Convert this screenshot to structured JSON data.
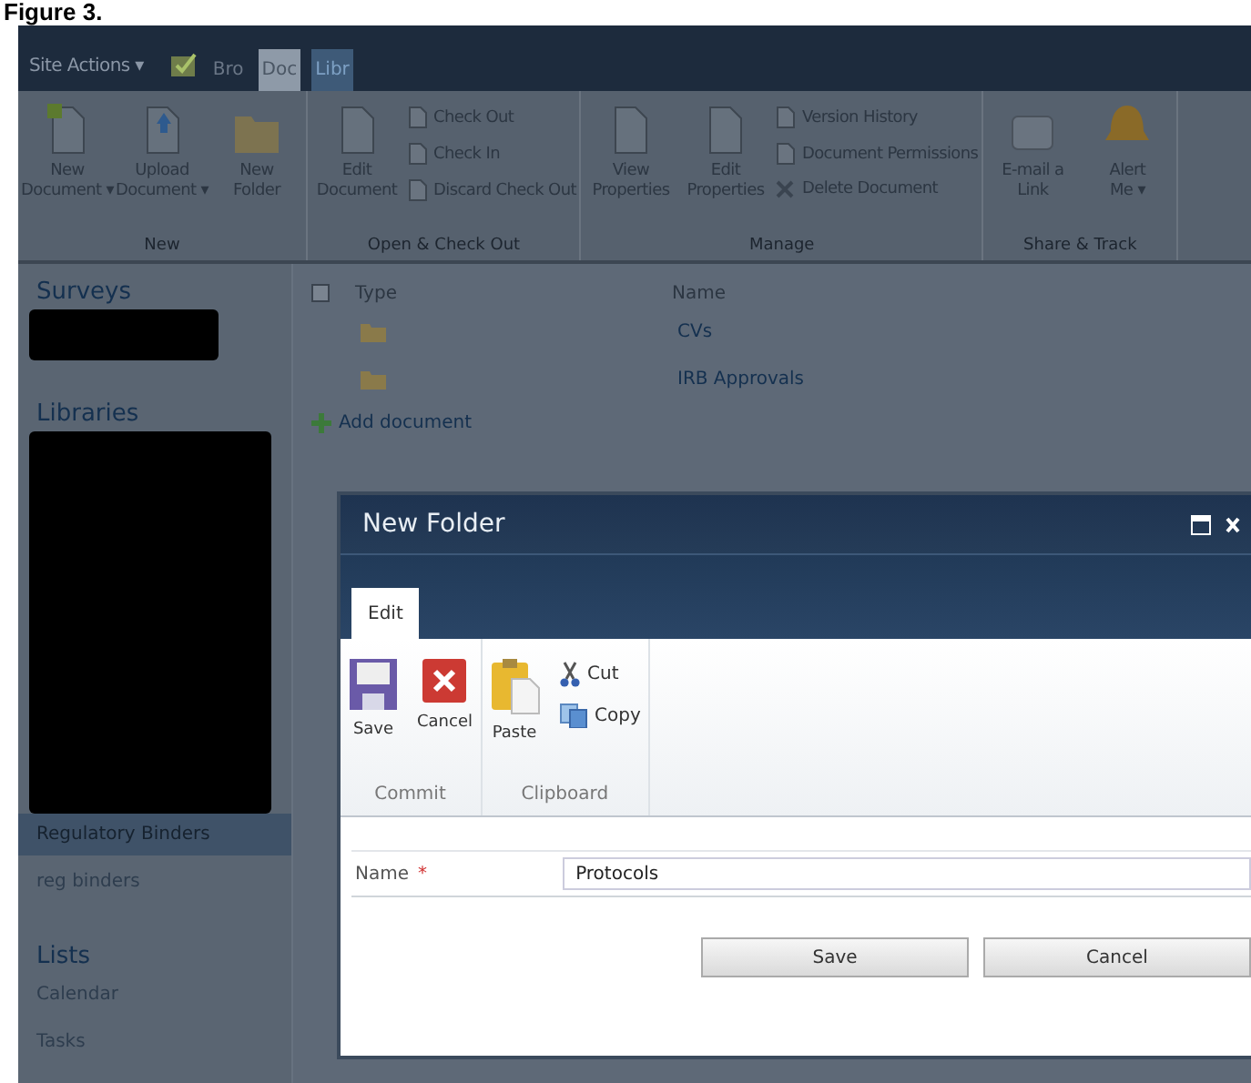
{
  "caption": "Figure 3.",
  "top_bar": {
    "site_actions": "Site Actions ▾",
    "tabs": [
      {
        "label": "Bro",
        "selected": false,
        "kind": "plain"
      },
      {
        "label": "Doc",
        "selected": true,
        "kind": "contextual"
      },
      {
        "label": "Libr",
        "selected": false,
        "kind": "contextual"
      }
    ]
  },
  "ribbon": {
    "groups": [
      {
        "title": "New",
        "items": [
          {
            "kind": "large",
            "lines": [
              "New",
              "Document ▾"
            ]
          },
          {
            "kind": "large",
            "lines": [
              "Upload",
              "Document ▾"
            ]
          },
          {
            "kind": "large",
            "lines": [
              "New",
              "Folder"
            ]
          }
        ]
      },
      {
        "title": "Open & Check Out",
        "items": [
          {
            "kind": "large",
            "lines": [
              "Edit",
              "Document"
            ]
          },
          {
            "kind": "small",
            "lines": [
              "Check Out"
            ]
          },
          {
            "kind": "small",
            "lines": [
              "Check In"
            ]
          },
          {
            "kind": "small",
            "lines": [
              "Discard Check Out"
            ]
          }
        ]
      },
      {
        "title": "Manage",
        "items": [
          {
            "kind": "large",
            "lines": [
              "View",
              "Properties"
            ]
          },
          {
            "kind": "large",
            "lines": [
              "Edit",
              "Properties"
            ]
          },
          {
            "kind": "small",
            "lines": [
              "Version History"
            ]
          },
          {
            "kind": "small",
            "lines": [
              "Document Permissions"
            ]
          },
          {
            "kind": "small",
            "lines": [
              "Delete Document"
            ]
          }
        ]
      },
      {
        "title": "Share & Track",
        "items": [
          {
            "kind": "large",
            "lines": [
              "E-mail a",
              "Link"
            ]
          },
          {
            "kind": "large",
            "lines": [
              "Alert",
              "Me ▾"
            ]
          }
        ]
      }
    ]
  },
  "sidebar": {
    "sections": [
      {
        "heading": "Surveys"
      },
      {
        "heading": "Libraries",
        "items": [
          {
            "label": "Regulatory Binders",
            "selected": true
          },
          {
            "label": "reg binders",
            "selected": false
          }
        ]
      },
      {
        "heading": "Lists",
        "items": [
          {
            "label": "Calendar",
            "selected": false
          },
          {
            "label": "Tasks",
            "selected": false
          }
        ]
      }
    ]
  },
  "list": {
    "select_all_checked": false,
    "columns": [
      "Type",
      "Name"
    ],
    "rows": [
      {
        "name": "CVs"
      },
      {
        "name": "IRB Approvals"
      }
    ],
    "add_link": "Add document"
  },
  "dialog": {
    "title": "New Folder",
    "tab": "Edit",
    "groups": [
      {
        "title": "Commit",
        "items": [
          {
            "kind": "large",
            "label": "Save"
          },
          {
            "kind": "large",
            "label": "Cancel"
          }
        ]
      },
      {
        "title": "Clipboard",
        "items": [
          {
            "kind": "large",
            "label": "Paste"
          },
          {
            "kind": "small",
            "label": "Cut"
          },
          {
            "kind": "small",
            "label": "Copy"
          }
        ]
      }
    ],
    "field": {
      "label": "Name",
      "required_mark": "*",
      "value": "Protocols"
    },
    "buttons": [
      "Save",
      "Cancel"
    ]
  }
}
